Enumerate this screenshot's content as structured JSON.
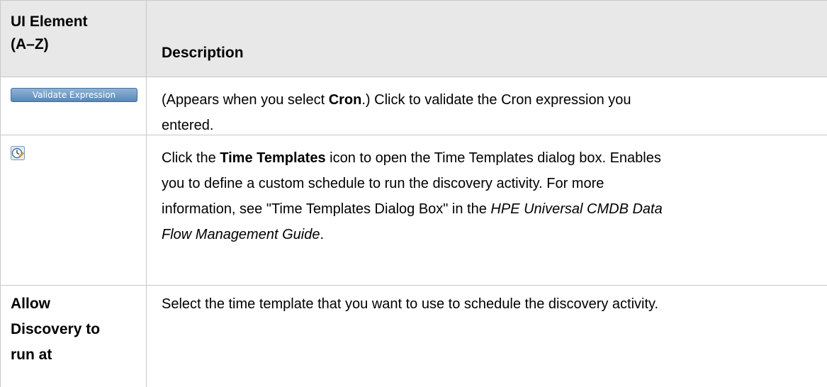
{
  "header": {
    "col1_line1": "UI Element",
    "col1_line2": "(A–Z)",
    "col2": "Description"
  },
  "rows": [
    {
      "element": {
        "type": "button",
        "label": "Validate Expression"
      },
      "description": {
        "pre": "(Appears when you select ",
        "bold": "Cron",
        "post": ".) Click to validate the Cron expression you",
        "line2": "entered."
      }
    },
    {
      "element": {
        "type": "icon",
        "icon": "time-templates-clock-icon"
      },
      "description": {
        "l1_pre": "Click the ",
        "l1_bold": "Time Templates",
        "l1_post": " icon to open the Time Templates dialog box. Enables",
        "l2": "you to define a custom schedule to run the discovery activity. For more",
        "l3_pre": "information, see \"Time Templates Dialog Box\" in the ",
        "l3_italic": "HPE Universal CMDB Data",
        "l4_italic": "Flow Management Guide",
        "l4_post": "."
      }
    },
    {
      "element": {
        "type": "text",
        "line1": "Allow",
        "line2": "Discovery to",
        "line3": "run at"
      },
      "description": {
        "text": "Select the time template that you want to use to schedule the discovery activity."
      }
    }
  ],
  "colors": {
    "header_bg": "#e8e8e8",
    "grid_line": "#c8c8c8",
    "button_bg_top": "#8fb3d6",
    "button_bg_bottom": "#5b87b6"
  }
}
